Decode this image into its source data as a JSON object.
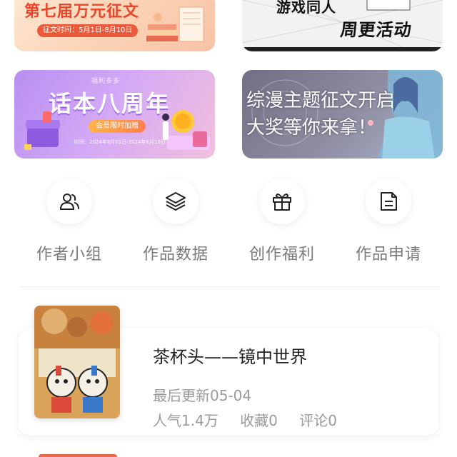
{
  "banners": [
    {
      "title": "第七届万元征文",
      "date": "征文时间：5月1日-8月10日",
      "color": "#e8462a"
    },
    {
      "title": "游戏同人",
      "subtitle": "周更活动"
    },
    {
      "tag": "福利多多",
      "title": "话本八周年",
      "pill": "会员限时加赠",
      "time": "时间：2024年8月01日-2024年8月10日",
      "color": "#b88ff0"
    },
    {
      "line1": "综漫主题征文开启",
      "line2": "大奖等你来拿！"
    }
  ],
  "shortcuts": [
    {
      "label": "作者小组",
      "icon": "users-icon"
    },
    {
      "label": "作品数据",
      "icon": "layers-icon"
    },
    {
      "label": "创作福利",
      "icon": "gift-icon"
    },
    {
      "label": "作品申请",
      "icon": "document-icon"
    }
  ],
  "work": {
    "title": "茶杯头——镜中世界",
    "updated": "最后更新05-04",
    "popularity": "人气1.4万",
    "favorites": "收藏0",
    "comments": "评论0"
  }
}
